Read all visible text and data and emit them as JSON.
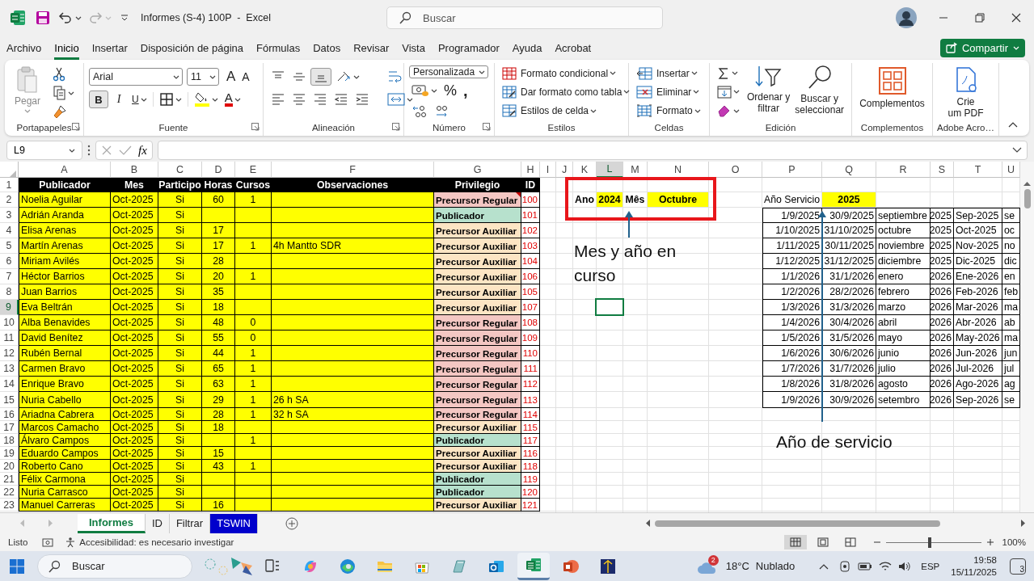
{
  "window": {
    "title": "Informes (S-4) 100P  -  Excel",
    "search_placeholder": "Buscar"
  },
  "menu": [
    {
      "label": "Archivo",
      "selected": false
    },
    {
      "label": "Inicio",
      "selected": true
    },
    {
      "label": "Insertar",
      "selected": false
    },
    {
      "label": "Disposición de página",
      "selected": false
    },
    {
      "label": "Fórmulas",
      "selected": false
    },
    {
      "label": "Datos",
      "selected": false
    },
    {
      "label": "Revisar",
      "selected": false
    },
    {
      "label": "Vista",
      "selected": false
    },
    {
      "label": "Programador",
      "selected": false
    },
    {
      "label": "Ayuda",
      "selected": false
    },
    {
      "label": "Acrobat",
      "selected": false
    }
  ],
  "share_button": "Compartir",
  "ribbon": {
    "clipboard": {
      "paste": "Pegar",
      "label": "Portapapeles"
    },
    "font": {
      "family": "Arial",
      "size": "11",
      "grow": "A",
      "shrink": "A",
      "bold": "B",
      "bold_active": true,
      "italic": "I",
      "underline": "U",
      "font_color": "A",
      "label": "Fuente"
    },
    "alignment": {
      "bottom_active": true,
      "label": "Alineación"
    },
    "number": {
      "format": "Personalizada",
      "percent": "%",
      "comma": ",",
      "label": "Número"
    },
    "styles": {
      "items": [
        "Formato condicional",
        "Dar formato como tabla",
        "Estilos de celda"
      ],
      "label": "Estilos"
    },
    "cells": {
      "items": [
        "Insertar",
        "Eliminar",
        "Formato"
      ],
      "label": "Celdas"
    },
    "editing": {
      "sort": "Ordenar y\nfiltrar",
      "find": "Buscar y\nseleccionar",
      "label": "Edición"
    },
    "addins": {
      "button": "Complementos",
      "label": "Complementos"
    },
    "adobe": {
      "button": "Crie\num PDF",
      "label": "Adobe Acro…"
    }
  },
  "formula_bar": {
    "name_box": "L9",
    "fx": "fx"
  },
  "sheet": {
    "columns": [
      {
        "label": "A",
        "selected": false
      },
      {
        "label": "B",
        "selected": false
      },
      {
        "label": "C",
        "selected": false
      },
      {
        "label": "D",
        "selected": false
      },
      {
        "label": "E",
        "selected": false
      },
      {
        "label": "F",
        "selected": false
      },
      {
        "label": "G",
        "selected": false
      },
      {
        "label": "H",
        "selected": false
      },
      {
        "label": "I",
        "selected": false
      },
      {
        "label": "J",
        "selected": false
      },
      {
        "label": "K",
        "selected": false
      },
      {
        "label": "L",
        "selected": true
      },
      {
        "label": "M",
        "selected": false
      },
      {
        "label": "N",
        "selected": false
      },
      {
        "label": "O",
        "selected": false
      },
      {
        "label": "P",
        "selected": false
      },
      {
        "label": "Q",
        "selected": false
      },
      {
        "label": "R",
        "selected": false
      },
      {
        "label": "S",
        "selected": false
      },
      {
        "label": "T",
        "selected": false
      },
      {
        "label": "U",
        "selected": false
      }
    ],
    "rows": [
      {
        "label": "1",
        "selected": false
      },
      {
        "label": "2",
        "selected": false
      },
      {
        "label": "3",
        "selected": false
      },
      {
        "label": "4",
        "selected": false
      },
      {
        "label": "5",
        "selected": false
      },
      {
        "label": "6",
        "selected": false
      },
      {
        "label": "7",
        "selected": false
      },
      {
        "label": "8",
        "selected": false
      },
      {
        "label": "9",
        "selected": true
      },
      {
        "label": "10",
        "selected": false
      },
      {
        "label": "11",
        "selected": false
      },
      {
        "label": "12",
        "selected": false
      },
      {
        "label": "13",
        "selected": false
      },
      {
        "label": "14",
        "selected": false
      },
      {
        "label": "15",
        "selected": false
      },
      {
        "label": "16",
        "selected": false
      },
      {
        "label": "17",
        "selected": false
      },
      {
        "label": "18",
        "selected": false
      },
      {
        "label": "19",
        "selected": false
      },
      {
        "label": "20",
        "selected": false
      },
      {
        "label": "21",
        "selected": false
      },
      {
        "label": "22",
        "selected": false
      },
      {
        "label": "23",
        "selected": false
      }
    ],
    "header": [
      "Publicador",
      "Mes",
      "Participo",
      "Horas",
      "Cursos",
      "Observaciones",
      "Privilegio",
      "ID"
    ],
    "records": [
      {
        "publicador": "Noelia Aguilar",
        "mes": "Oct-2025",
        "participo": "Si",
        "horas": "60",
        "cursos": "1",
        "privilegio": "Precursor Regular",
        "color": "#f4c7c3",
        "id": "100",
        "comment": true
      },
      {
        "publicador": "Adrián Aranda",
        "mes": "Oct-2025",
        "participo": "Si",
        "privilegio": "Publicador",
        "color": "#b7e1cd",
        "id": "101",
        "comment": false
      },
      {
        "publicador": "Elisa Arenas",
        "mes": "Oct-2025",
        "participo": "Si",
        "horas": "17",
        "privilegio": "Precursor Auxiliar",
        "color": "#fce5c4",
        "id": "102",
        "comment": false
      },
      {
        "publicador": "Martín Arenas",
        "mes": "Oct-2025",
        "participo": "Si",
        "horas": "17",
        "cursos": "1",
        "observaciones": "4h Mantto SDR",
        "privilegio": "Precursor Auxiliar",
        "color": "#fce5c4",
        "id": "103",
        "comment": false
      },
      {
        "publicador": "Miriam Avilés",
        "mes": "Oct-2025",
        "participo": "Si",
        "horas": "28",
        "privilegio": "Precursor Auxiliar",
        "color": "#fce5c4",
        "id": "104",
        "comment": false
      },
      {
        "publicador": "Héctor Barrios",
        "mes": "Oct-2025",
        "participo": "Si",
        "horas": "20",
        "cursos": "1",
        "privilegio": "Precursor Auxiliar",
        "color": "#fce5c4",
        "id": "106",
        "comment": false
      },
      {
        "publicador": "Juan Barrios",
        "mes": "Oct-2025",
        "participo": "Si",
        "horas": "35",
        "privilegio": "Precursor Auxiliar",
        "color": "#fce5c4",
        "id": "105",
        "comment": false
      },
      {
        "publicador": "Eva Beltrán",
        "mes": "Oct-2025",
        "participo": "Si",
        "horas": "18",
        "privilegio": "Precursor Auxiliar",
        "color": "#fce5c4",
        "id": "107",
        "comment": false
      },
      {
        "publicador": "Alba Benavides",
        "mes": "Oct-2025",
        "participo": "Si",
        "horas": "48",
        "cursos": "0",
        "privilegio": "Precursor Regular",
        "color": "#f4c7c3",
        "id": "108",
        "comment": false
      },
      {
        "publicador": "David Benítez",
        "mes": "Oct-2025",
        "participo": "Si",
        "horas": "55",
        "cursos": "0",
        "privilegio": "Precursor Regular",
        "color": "#f4c7c3",
        "id": "109",
        "comment": false
      },
      {
        "publicador": "Rubén Bernal",
        "mes": "Oct-2025",
        "participo": "Si",
        "horas": "44",
        "cursos": "1",
        "privilegio": "Precursor Regular",
        "color": "#f4c7c3",
        "id": "110",
        "comment": false
      },
      {
        "publicador": "Carmen Bravo",
        "mes": "Oct-2025",
        "participo": "Si",
        "horas": "65",
        "cursos": "1",
        "privilegio": "Precursor Regular",
        "color": "#f4c7c3",
        "id": "111",
        "comment": false
      },
      {
        "publicador": "Enrique Bravo",
        "mes": "Oct-2025",
        "participo": "Si",
        "horas": "63",
        "cursos": "1",
        "privilegio": "Precursor Regular",
        "color": "#f4c7c3",
        "id": "112",
        "comment": false
      },
      {
        "publicador": "Nuria Cabello",
        "mes": "Oct-2025",
        "participo": "Si",
        "horas": "29",
        "cursos": "1",
        "observaciones": "26 h SA",
        "privilegio": "Precursor Regular",
        "color": "#f4c7c3",
        "id": "113",
        "comment": false
      },
      {
        "publicador": "Ariadna Cabrera",
        "mes": "Oct-2025",
        "participo": "Si",
        "horas": "28",
        "cursos": "1",
        "observaciones": "32 h SA",
        "privilegio": "Precursor Regular",
        "color": "#f4c7c3",
        "id": "114",
        "comment": false
      },
      {
        "publicador": "Marcos Camacho",
        "mes": "Oct-2025",
        "participo": "Si",
        "horas": "18",
        "privilegio": "Precursor Auxiliar",
        "color": "#fce5c4",
        "id": "115",
        "comment": false
      },
      {
        "publicador": "Álvaro Campos",
        "mes": "Oct-2025",
        "participo": "Si",
        "cursos": "1",
        "privilegio": "Publicador",
        "color": "#b7e1cd",
        "id": "117",
        "comment": false
      },
      {
        "publicador": "Eduardo Campos",
        "mes": "Oct-2025",
        "participo": "Si",
        "horas": "15",
        "privilegio": "Precursor Auxiliar",
        "color": "#fce5c4",
        "id": "116",
        "comment": false
      },
      {
        "publicador": "Roberto Cano",
        "mes": "Oct-2025",
        "participo": "Si",
        "horas": "43",
        "cursos": "1",
        "privilegio": "Precursor Auxiliar",
        "color": "#fce5c4",
        "id": "118",
        "comment": false
      },
      {
        "publicador": "Félix Carmona",
        "mes": "Oct-2025",
        "participo": "Si",
        "privilegio": "Publicador",
        "color": "#b7e1cd",
        "id": "119",
        "comment": false
      },
      {
        "publicador": "Nuria Carrasco",
        "mes": "Oct-2025",
        "participo": "Si",
        "privilegio": "Publicador",
        "color": "#b7e1cd",
        "id": "120",
        "comment": false
      },
      {
        "publicador": "Manuel Carreras",
        "mes": "Oct-2025",
        "participo": "Si",
        "horas": "16",
        "privilegio": "Precursor Auxiliar",
        "color": "#fce5c4",
        "id": "121",
        "comment": false
      }
    ],
    "current": {
      "year_label": "Ano",
      "year": "2024",
      "month_label": "Mês",
      "month": "Octubre"
    },
    "service": {
      "label": "Año Servicio",
      "year": "2025",
      "rows": [
        {
          "start": "1/9/2025",
          "end": "30/9/2025",
          "month": "septiembre",
          "year": "2025",
          "label": "Sep-2025",
          "cut": "se"
        },
        {
          "start": "1/10/2025",
          "end": "31/10/2025",
          "month": "octubre",
          "year": "2025",
          "label": "Oct-2025",
          "cut": "oc"
        },
        {
          "start": "1/11/2025",
          "end": "30/11/2025",
          "month": "noviembre",
          "year": "2025",
          "label": "Nov-2025",
          "cut": "no"
        },
        {
          "start": "1/12/2025",
          "end": "31/12/2025",
          "month": "diciembre",
          "year": "2025",
          "label": "Dic-2025",
          "cut": "dic"
        },
        {
          "start": "1/1/2026",
          "end": "31/1/2026",
          "month": "enero",
          "year": "2026",
          "label": "Ene-2026",
          "cut": "en"
        },
        {
          "start": "1/2/2026",
          "end": "28/2/2026",
          "month": "febrero",
          "year": "2026",
          "label": "Feb-2026",
          "cut": "feb"
        },
        {
          "start": "1/3/2026",
          "end": "31/3/2026",
          "month": "marzo",
          "year": "2026",
          "label": "Mar-2026",
          "cut": "ma"
        },
        {
          "start": "1/4/2026",
          "end": "30/4/2026",
          "month": "abril",
          "year": "2026",
          "label": "Abr-2026",
          "cut": "ab"
        },
        {
          "start": "1/5/2026",
          "end": "31/5/2026",
          "month": "mayo",
          "year": "2026",
          "label": "May-2026",
          "cut": "ma"
        },
        {
          "start": "1/6/2026",
          "end": "30/6/2026",
          "month": "junio",
          "year": "2026",
          "label": "Jun-2026",
          "cut": "jun"
        },
        {
          "start": "1/7/2026",
          "end": "31/7/2026",
          "month": "julio",
          "year": "2026",
          "label": "Jul-2026",
          "cut": "jul"
        },
        {
          "start": "1/8/2026",
          "end": "31/8/2026",
          "month": "agosto",
          "year": "2026",
          "label": "Ago-2026",
          "cut": "ag"
        },
        {
          "start": "1/9/2026",
          "end": "30/9/2026",
          "month": "setembro",
          "year": "2026",
          "label": "Sep-2026",
          "cut": "se"
        }
      ]
    },
    "annotations": [
      "Mes y año en curso",
      "Año de servicio"
    ]
  },
  "sheet_tabs": [
    {
      "label": "Informes",
      "selected": true
    },
    {
      "label": "ID",
      "selected": false
    },
    {
      "label": "Filtrar",
      "selected": false
    },
    {
      "label": "TSWIN",
      "selected": false,
      "color": "#0000cc"
    }
  ],
  "status_bar": {
    "mode": "Listo",
    "accessibility": "Accesibilidad: es necesario investigar",
    "views": [
      {
        "kind": "normal",
        "selected": true
      },
      {
        "kind": "layout",
        "selected": false
      },
      {
        "kind": "pagebreak",
        "selected": false
      }
    ],
    "zoom": {
      "level": 0.46
    },
    "zoom_text": "100%"
  },
  "taskbar": {
    "search": "Buscar",
    "apps": [
      {
        "kind": "taskview",
        "selected": false
      },
      {
        "kind": "swirl",
        "selected": false
      },
      {
        "kind": "browser",
        "selected": false
      },
      {
        "kind": "folder",
        "selected": false
      },
      {
        "kind": "store",
        "selected": false
      },
      {
        "kind": "glass",
        "selected": false
      },
      {
        "kind": "mail",
        "selected": false
      },
      {
        "kind": "sheet",
        "selected": true
      },
      {
        "kind": "slides",
        "selected": false
      },
      {
        "kind": "app",
        "selected": false
      }
    ],
    "weather": {
      "badge": "2",
      "temp": "18°C",
      "condition": "Nublado"
    },
    "language": "ESP",
    "time": "19:58",
    "date": "15/11/2025",
    "notifications": "3"
  }
}
